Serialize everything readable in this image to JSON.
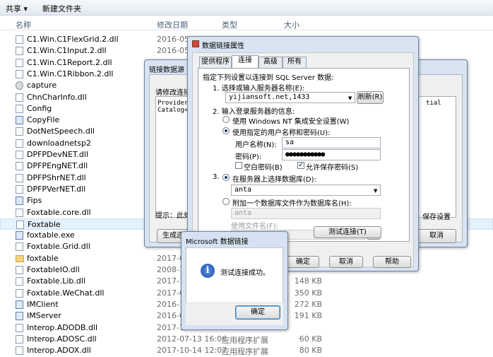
{
  "toolbar": {
    "share_label": "共享 ▾",
    "new_folder_label": "新建文件夹"
  },
  "columns": {
    "name": "名称",
    "date": "修改日期",
    "type": "类型",
    "size": "大小"
  },
  "files": [
    {
      "name": "C1.Win.C1FlexGrid.2.dll",
      "date": "2016-05-05",
      "type": "",
      "size": "",
      "icon": "dll"
    },
    {
      "name": "C1.Win.C1Input.2.dll",
      "date": "2016-05-05",
      "type": "",
      "size": "",
      "icon": "dll"
    },
    {
      "name": "C1.Win.C1Report.2.dll",
      "date": "",
      "type": "",
      "size": "",
      "icon": "dll"
    },
    {
      "name": "C1.Win.C1Ribbon.2.dll",
      "date": "",
      "type": "",
      "size": "",
      "icon": "dll"
    },
    {
      "name": "capture",
      "date": "",
      "type": "",
      "size": "",
      "icon": "gear"
    },
    {
      "name": "ChnCharInfo.dll",
      "date": "",
      "type": "",
      "size": "",
      "icon": "dll"
    },
    {
      "name": "Config",
      "date": "",
      "type": "",
      "size": "",
      "icon": "dll"
    },
    {
      "name": "CopyFile",
      "date": "",
      "type": "",
      "size": "",
      "icon": "exe"
    },
    {
      "name": "DotNetSpeech.dll",
      "date": "",
      "type": "",
      "size": "",
      "icon": "dll"
    },
    {
      "name": "downloadnetsp2",
      "date": "",
      "type": "",
      "size": "",
      "icon": "dll"
    },
    {
      "name": "DPFPDevNET.dll",
      "date": "",
      "type": "",
      "size": "",
      "icon": "dll"
    },
    {
      "name": "DPFPEngNET.dll",
      "date": "",
      "type": "",
      "size": "",
      "icon": "dll"
    },
    {
      "name": "DPFPShrNET.dll",
      "date": "",
      "type": "",
      "size": "",
      "icon": "dll"
    },
    {
      "name": "DPFPVerNET.dll",
      "date": "",
      "type": "",
      "size": "",
      "icon": "dll"
    },
    {
      "name": "Fips",
      "date": "",
      "type": "",
      "size": "",
      "icon": "exe"
    },
    {
      "name": "Foxtable.core.dll",
      "date": "",
      "type": "",
      "size": "",
      "icon": "dll"
    },
    {
      "name": "Foxtable",
      "date": "",
      "type": "",
      "size": "",
      "icon": "dll"
    },
    {
      "name": "foxtable.exe",
      "date": "",
      "type": "",
      "size": "",
      "icon": "exe"
    },
    {
      "name": "Foxtable.Grid.dll",
      "date": "",
      "type": "",
      "size": "",
      "icon": "dll"
    },
    {
      "name": "foxtable",
      "date": "2017-0",
      "type": "",
      "size": "",
      "icon": "fold"
    },
    {
      "name": "FoxtableIO.dll",
      "date": "2008-1",
      "type": "",
      "size": "",
      "icon": "dll"
    },
    {
      "name": "Foxtable.Lib.dll",
      "date": "2017-1",
      "type": "",
      "size": "148 KB",
      "icon": "dll"
    },
    {
      "name": "Foxtable.WeChat.dll",
      "date": "2017-0",
      "type": "",
      "size": "350 KB",
      "icon": "dll"
    },
    {
      "name": "IMClient",
      "date": "2016-1",
      "type": "",
      "size": "272 KB",
      "icon": "exe"
    },
    {
      "name": "IMServer",
      "date": "2016-0",
      "type": "",
      "size": "191 KB",
      "icon": "exe"
    },
    {
      "name": "Interop.ADODB.dll",
      "date": "2017-1",
      "type": "",
      "size": "",
      "icon": "dll"
    },
    {
      "name": "Interop.ADOSC.dll",
      "date": "2012-07-13 16:06",
      "type": "应用程序扩展",
      "size": "60 KB",
      "icon": "dll"
    },
    {
      "name": "Interop.ADOX.dll",
      "date": "2017-10-14 12:07",
      "type": "应用程序扩展",
      "size": "80 KB",
      "icon": "dll"
    }
  ],
  "ds_window": {
    "title": "链接数据源",
    "prompt": "请修改连接字",
    "conn_text_1": "Provider=SQ",
    "conn_text_2": "Catalog=ant",
    "conn_text_right": "tial",
    "hint": "提示：此处是",
    "generate_btn": "生成连",
    "save_label": "保存设置",
    "cancel_btn": "取消"
  },
  "props": {
    "title": "数据链接属性",
    "tabs": [
      "提供程序",
      "连接",
      "高级",
      "所有"
    ],
    "active_tab": "连接",
    "heading": "指定下列设置以连接到 SQL Server 数据:",
    "step1": "1. 选择或输入服务器名称(E):",
    "server": "yijiansoft.net,1433",
    "refresh_btn": "刷新(R)",
    "step2": "2. 输入登录服务器的信息:",
    "opt_nt": "使用 Windows NT 集成安全设置(W)",
    "opt_user": "使用指定的用户名称和密码(U):",
    "user_label": "用户名称(N):",
    "user_value": "sa",
    "pwd_label": "密码(P):",
    "pwd_value": "●●●●●●●●●●●",
    "blank_pwd": "空白密码(B)",
    "allow_save": "允许保存密码(S)",
    "step3": "3.",
    "opt_db": "在服务器上选择数据库(D):",
    "db_value": "anta",
    "opt_attach": "附加一个数据库文件作为数据库名(H):",
    "attach_value": "anta",
    "filename_label": "使用文件名(F):",
    "browse_btn": "...",
    "test_btn": "测试连接(T)",
    "ok_btn": "确定",
    "cancel_btn": "取消",
    "help_btn": "帮助"
  },
  "msg": {
    "title": "Microsoft 数据链接",
    "icon": "info-icon",
    "text": "测试连接成功。",
    "ok_btn": "确定"
  }
}
